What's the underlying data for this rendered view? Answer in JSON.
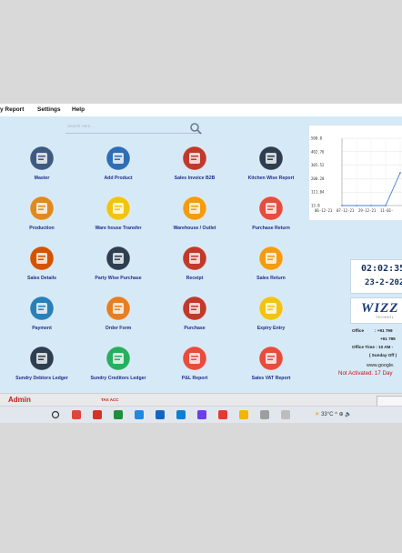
{
  "menu": [
    "y Report",
    "Settings",
    "Help"
  ],
  "search": {
    "placeholder": "Search Here..."
  },
  "tiles": [
    {
      "label": "Master",
      "icon": "master-icon"
    },
    {
      "label": "Add Product",
      "icon": "add-product-icon"
    },
    {
      "label": "Sales Invoice B2B",
      "icon": "sales-invoice-icon"
    },
    {
      "label": "Kitchen Wise Report",
      "icon": "kitchen-report-icon"
    },
    {
      "label": "Production",
      "icon": "production-icon"
    },
    {
      "label": "Ware house Transfer",
      "icon": "warehouse-transfer-icon"
    },
    {
      "label": "Warehouse / Outlet",
      "icon": "warehouse-outlet-icon"
    },
    {
      "label": "Purchase Return",
      "icon": "purchase-return-icon"
    },
    {
      "label": "Sales Details",
      "icon": "sales-details-icon"
    },
    {
      "label": "Party Wise Purchase",
      "icon": "party-purchase-icon"
    },
    {
      "label": "Receipt",
      "icon": "receipt-icon"
    },
    {
      "label": "Sales Return",
      "icon": "sales-return-icon"
    },
    {
      "label": "Payment",
      "icon": "payment-icon"
    },
    {
      "label": "Order Form",
      "icon": "order-form-icon"
    },
    {
      "label": "Purchase",
      "icon": "purchase-icon"
    },
    {
      "label": "Expiry Entry",
      "icon": "expiry-icon"
    },
    {
      "label": "Sundry Debtors Ledger",
      "icon": "debtors-ledger-icon"
    },
    {
      "label": "Sundry Creditors Ledger",
      "icon": "creditors-ledger-icon"
    },
    {
      "label": "P&L Report",
      "icon": "pl-report-icon"
    },
    {
      "label": "Sales VAT Report",
      "icon": "vat-report-icon"
    }
  ],
  "colors": {
    "tiles": [
      "#3d5a80",
      "#2f6db5",
      "#c0392b",
      "#2c3e50",
      "#e08a1e",
      "#f1c40f",
      "#f39c12",
      "#e74c3c",
      "#d35400",
      "#2c3e50",
      "#c0392b",
      "#f39c12",
      "#2980b9",
      "#e67e22",
      "#c0392b",
      "#f1c40f",
      "#2c3e50",
      "#27ae60",
      "#e74c3c",
      "#e74c3c"
    ],
    "label": "#1d2f8c",
    "alert": "#c01818",
    "chart_line": "#4a7fd0"
  },
  "chart_data": {
    "type": "line",
    "x": [
      "06-12-21",
      "07-12-21",
      "29-12-21",
      "11-01-"
    ],
    "series": [
      {
        "values": [
          13.8,
          13.8,
          13.8,
          13.8,
          250.0
        ]
      }
    ],
    "y_ticks": [
      "500.0",
      "402.76",
      "305.52",
      "208.28",
      "111.04",
      "13.8"
    ],
    "ylim": [
      13.8,
      500.0
    ],
    "grid": true
  },
  "clock": {
    "time": "02:02:35",
    "date": "23-2-202"
  },
  "brand": {
    "logo_text": "WIZZ",
    "tagline": "TECHNOL"
  },
  "contact": {
    "office_label": "Office",
    "office_value": ": +91 799",
    "office_value2": "+91 799",
    "time_label": "Office Time : 10 AM -",
    "sunday": "( Sunday Off )",
    "web": "www.google."
  },
  "not_activated": "Not Activated. 17 Day",
  "status": {
    "user": "Admin",
    "company": "TAX ACC"
  },
  "taskbar": {
    "apps": [
      "search-icon",
      "chrome-icon",
      "chrome-notify-icon",
      "excel-icon",
      "edge-icon",
      "browser-icon",
      "mail-icon",
      "vpn-icon",
      "anydesk-icon",
      "explorer-icon",
      "app-icon",
      "app2-icon"
    ],
    "weather": "33°C",
    "tray": "^ ⊕ 🔈"
  }
}
